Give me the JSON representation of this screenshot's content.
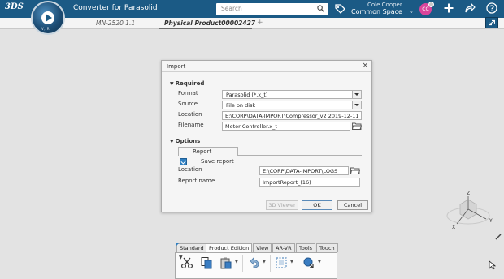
{
  "topbar": {
    "brand": "3DS",
    "compass_label": "V, R",
    "app_title": "Converter for Parasolid",
    "search_placeholder": "Search",
    "user_name": "Cole Cooper",
    "space_name": "Common Space",
    "avatar_initials": "CC",
    "accent": "#1b5a85"
  },
  "tabs": [
    {
      "label": "MN-2520 1.1",
      "active": false
    },
    {
      "label": "Physical Product00002427",
      "active": true
    }
  ],
  "tab_add": "+",
  "dialog": {
    "title": "Import",
    "close": "×",
    "required_label": "Required",
    "format_label": "Format",
    "format_value": "Parasolid (*.x_t)",
    "source_label": "Source",
    "source_value": "File on disk",
    "location_label": "Location",
    "location_value": "E:\\CORP\\DATA-IMPORT\\Compressor_v2 2019-12-11",
    "filename_label": "Filename",
    "filename_value": "Motor Controller.x_t",
    "options_label": "Options",
    "report_tab_label": "Report",
    "save_report_label": "Save report",
    "save_report_checked": true,
    "report_location_label": "Location",
    "report_location_value": "E:\\CORP\\DATA-IMPORT\\LOGS",
    "report_name_label": "Report name",
    "report_name_value": "ImportReport_(16)",
    "viewer_button": "3D Viewer",
    "ok_button": "OK",
    "cancel_button": "Cancel"
  },
  "viewcube": {
    "z": "Z",
    "x": "X",
    "y": "Y"
  },
  "actionbar": {
    "tabs": [
      "Standard",
      "Product Edition",
      "View",
      "AR-VR",
      "Tools",
      "Touch"
    ],
    "active_tab": "Product Edition",
    "icons": [
      "cut-icon",
      "copy-icon",
      "paste-icon",
      "undo-icon",
      "selection-icon",
      "reorder-icon"
    ]
  }
}
